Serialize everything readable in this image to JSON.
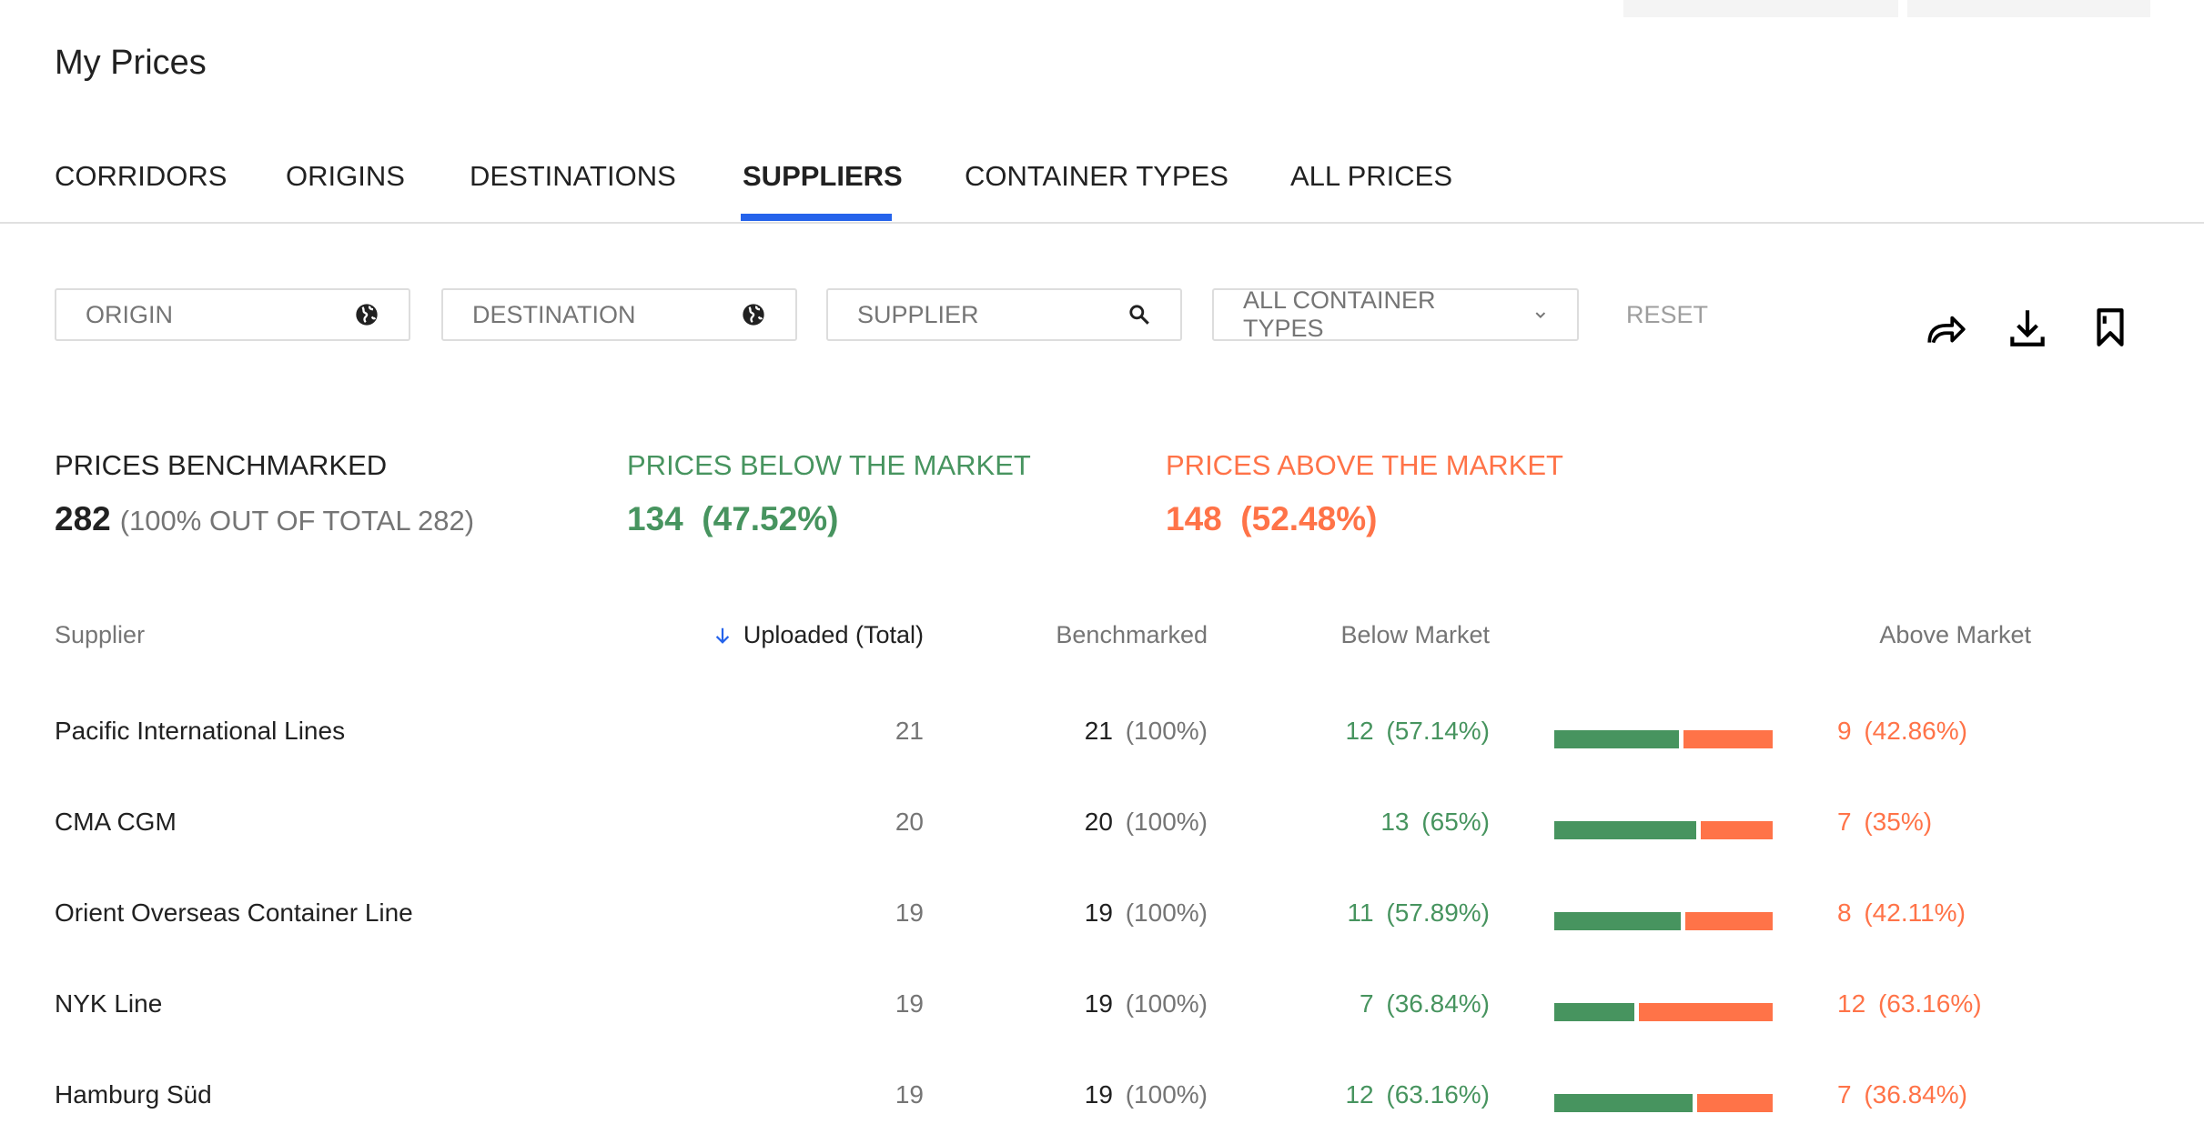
{
  "header": {
    "title": "My Prices"
  },
  "tabs": [
    {
      "label": "CORRIDORS"
    },
    {
      "label": "ORIGINS"
    },
    {
      "label": "DESTINATIONS"
    },
    {
      "label": "SUPPLIERS",
      "active": true
    },
    {
      "label": "CONTAINER TYPES"
    },
    {
      "label": "ALL PRICES"
    }
  ],
  "filters": {
    "origin": "ORIGIN",
    "destination": "DESTINATION",
    "supplier": "SUPPLIER",
    "container": "ALL CONTAINER TYPES",
    "reset": "RESET"
  },
  "icons": {
    "origin": "globe-icon",
    "destination": "globe-icon",
    "supplier": "search-icon",
    "container": "chevron-down-icon",
    "actions": [
      "share-icon",
      "download-icon",
      "bookmark-icon"
    ]
  },
  "stats": {
    "benchmarked": {
      "label": "PRICES BENCHMARKED",
      "value": "282",
      "sub": "(100% OUT OF TOTAL 282)"
    },
    "below": {
      "label": "PRICES BELOW THE MARKET",
      "value": "134  (47.52%)"
    },
    "above": {
      "label": "PRICES ABOVE THE MARKET",
      "value": "148  (52.48%)"
    }
  },
  "colors": {
    "below": "#47945f",
    "above": "#ff7348",
    "accent": "#2563eb"
  },
  "table": {
    "headers": {
      "supplier": "Supplier",
      "uploaded": "Uploaded (Total)",
      "benchmarked": "Benchmarked",
      "below": "Below Market",
      "above": "Above Market"
    },
    "sort": {
      "column": "uploaded",
      "direction": "descending"
    },
    "rows": [
      {
        "supplier": "Pacific International Lines",
        "uploaded": "21",
        "bench": "21",
        "bench_pct": "(100%)",
        "below": "12",
        "below_pct": "(57.14%)",
        "above": "9",
        "above_pct": "(42.86%)",
        "below_share": 57.14
      },
      {
        "supplier": "CMA CGM",
        "uploaded": "20",
        "bench": "20",
        "bench_pct": "(100%)",
        "below": "13",
        "below_pct": "(65%)",
        "above": "7",
        "above_pct": "(35%)",
        "below_share": 65
      },
      {
        "supplier": "Orient Overseas Container Line",
        "uploaded": "19",
        "bench": "19",
        "bench_pct": "(100%)",
        "below": "11",
        "below_pct": "(57.89%)",
        "above": "8",
        "above_pct": "(42.11%)",
        "below_share": 57.89
      },
      {
        "supplier": "NYK Line",
        "uploaded": "19",
        "bench": "19",
        "bench_pct": "(100%)",
        "below": "7",
        "below_pct": "(36.84%)",
        "above": "12",
        "above_pct": "(63.16%)",
        "below_share": 36.84
      },
      {
        "supplier": "Hamburg Süd",
        "uploaded": "19",
        "bench": "19",
        "bench_pct": "(100%)",
        "below": "12",
        "below_pct": "(63.16%)",
        "above": "7",
        "above_pct": "(36.84%)",
        "below_share": 63.16
      }
    ]
  }
}
